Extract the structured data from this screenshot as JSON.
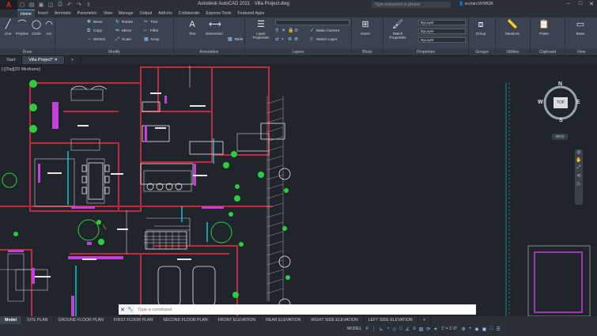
{
  "app": {
    "title": "Autodesk AutoCAD 2021 · Villa Project.dwg",
    "logo": "A",
    "search_placeholder": "Type a keyword or phrase",
    "user": "vu.tran.NVWGN",
    "window_controls": [
      "–",
      "□",
      "✕"
    ]
  },
  "quick_access": [
    "new-icon",
    "open-icon",
    "save-icon",
    "saveas-icon",
    "print-icon",
    "undo-icon",
    "redo-icon",
    "share-icon"
  ],
  "ribbon_tabs": [
    {
      "label": "Home",
      "active": true
    },
    {
      "label": "Insert"
    },
    {
      "label": "Annotate"
    },
    {
      "label": "Parametric"
    },
    {
      "label": "View"
    },
    {
      "label": "Manage"
    },
    {
      "label": "Output"
    },
    {
      "label": "Add-ins"
    },
    {
      "label": "Collaborate"
    },
    {
      "label": "Express Tools"
    },
    {
      "label": "Featured Apps"
    }
  ],
  "ribbon": {
    "draw": {
      "title": "Draw",
      "line": "Line",
      "polyline": "Polyline",
      "circle": "Circle",
      "arc": "Arc"
    },
    "modify": {
      "title": "Modify",
      "move": "Move",
      "rotate": "Rotate",
      "trim": "Trim",
      "copy": "Copy",
      "mirror": "Mirror",
      "fillet": "Fillet",
      "stretch": "Stretch",
      "scale": "Scale",
      "array": "Array"
    },
    "annotation": {
      "title": "Annotation",
      "text": "Text",
      "dimension": "Dimension",
      "table": "Table"
    },
    "layers": {
      "title": "Layers",
      "layer_properties": "Layer Properties",
      "make_current": "Make Current",
      "match_layer": "Match Layer"
    },
    "block": {
      "title": "Block",
      "insert": "Insert"
    },
    "properties": {
      "title": "Properties",
      "match_properties": "Match Properties",
      "color": "ByLayer",
      "linetype": "ByLayer",
      "lineweight": "ByLayer"
    },
    "groups": {
      "title": "Groups",
      "group": "Group"
    },
    "utilities": {
      "title": "Utilities",
      "measure": "Measure"
    },
    "clipboard": {
      "title": "Clipboard",
      "paste": "Paste"
    },
    "view": {
      "title": "View",
      "base": "Base"
    }
  },
  "file_tabs": [
    {
      "label": "Start"
    },
    {
      "label": "Villa Project*",
      "active": true
    }
  ],
  "viewport": {
    "label": "[-][Top][2D Wireframe]",
    "viewcube": {
      "n": "N",
      "s": "S",
      "e": "E",
      "w": "W",
      "top": "TOP"
    },
    "wcs": "WCS"
  },
  "command_line": {
    "placeholder": "Type a command"
  },
  "layout_tabs": [
    {
      "label": "Model",
      "active": true
    },
    {
      "label": "SITE PLAN"
    },
    {
      "label": "GROUND FLOOR PLAN"
    },
    {
      "label": "FIRST FLOOR PLAN"
    },
    {
      "label": "SECOND FLOOR PLAN"
    },
    {
      "label": "FRONT ELEVATION"
    },
    {
      "label": "REAR ELEVATION"
    },
    {
      "label": "RIGHT SIDE ELEVATION"
    },
    {
      "label": "LEFT SIDE ELEVATION"
    }
  ],
  "status": {
    "model": "MODEL",
    "scale": "1' = 1'-0\"",
    "add": "+"
  },
  "colors": {
    "background": "#20252c",
    "wall": "#c0283b",
    "furniture": "#e6e6e6",
    "accent_magenta": "#c23fd8",
    "accent_cyan": "#17c4cc",
    "tree": "#2ecc40"
  }
}
